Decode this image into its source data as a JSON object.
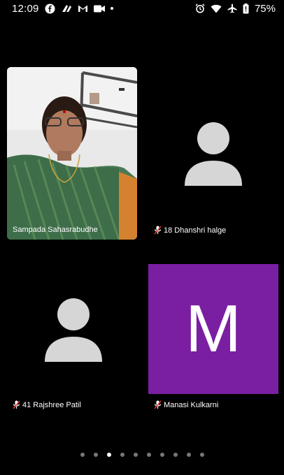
{
  "status_bar": {
    "time": "12:09",
    "battery": "75%",
    "left_icons": [
      "facebook-icon",
      "tool-icon",
      "gmail-icon",
      "video-icon",
      "dot-icon"
    ],
    "right_icons": [
      "alarm-icon",
      "wifi-icon",
      "airplane-icon",
      "battery-icon"
    ]
  },
  "participants": [
    {
      "name": "Sampada Sahasrabudhe",
      "muted": false,
      "view": "video"
    },
    {
      "name": "18 Dhanshri halge",
      "muted": true,
      "view": "placeholder"
    },
    {
      "name": "41 Rajshree Patil",
      "muted": true,
      "view": "placeholder"
    },
    {
      "name": "Manasi Kulkarni",
      "muted": true,
      "view": "initial",
      "initial": "M",
      "color": "#7b1fa2"
    }
  ],
  "pager": {
    "count": 10,
    "active_index": 2
  }
}
